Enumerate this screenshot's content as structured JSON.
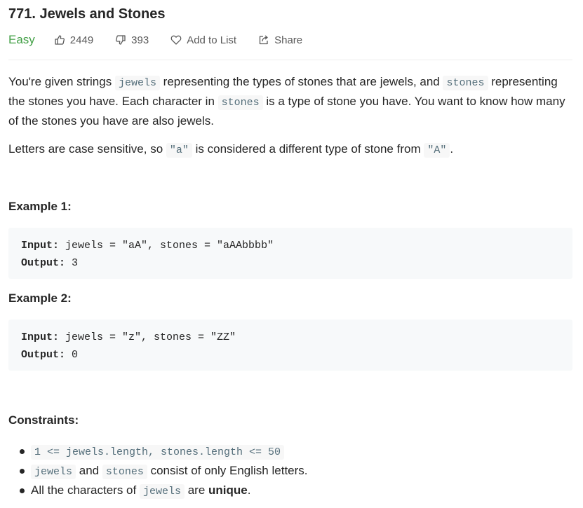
{
  "problem": {
    "title": "771. Jewels and Stones",
    "difficulty": "Easy",
    "likes": "2449",
    "dislikes": "393",
    "add_to_list": "Add to List",
    "share": "Share"
  },
  "description": {
    "p1_part1": "You're given strings ",
    "p1_code1": "jewels",
    "p1_part2": " representing the types of stones that are jewels, and ",
    "p1_code2": "stones",
    "p1_part3": " representing the stones you have. Each character in ",
    "p1_code3": "stones",
    "p1_part4": " is a type of stone you have. You want to know how many of the stones you have are also jewels.",
    "p2_part1": "Letters are case sensitive, so ",
    "p2_code1": "\"a\"",
    "p2_part2": " is considered a different type of stone from ",
    "p2_code2": "\"A\"",
    "p2_part3": "."
  },
  "examples": [
    {
      "heading": "Example 1:",
      "input_label": "Input:",
      "input_value": " jewels = \"aA\", stones = \"aAAbbbb\"",
      "output_label": "Output:",
      "output_value": " 3"
    },
    {
      "heading": "Example 2:",
      "input_label": "Input:",
      "input_value": " jewels = \"z\", stones = \"ZZ\"",
      "output_label": "Output:",
      "output_value": " 0"
    }
  ],
  "constraints": {
    "heading": "Constraints:",
    "c1_code": "1 <= jewels.length, stones.length <= 50",
    "c2_code1": "jewels",
    "c2_text1": " and ",
    "c2_code2": "stones",
    "c2_text2": " consist of only English letters.",
    "c3_text1": "All the characters of ",
    "c3_code": "jewels",
    "c3_text2": " are ",
    "c3_bold": "unique",
    "c3_text3": "."
  },
  "colors": {
    "difficulty_easy": "#43a047",
    "code_text": "#546e7a",
    "code_bg": "#f7f7f7",
    "pre_bg": "#f7f9fa"
  },
  "icons": {
    "like": "thumbs-up-icon",
    "dislike": "thumbs-down-icon",
    "add_to_list": "heart-icon",
    "share": "share-icon"
  }
}
